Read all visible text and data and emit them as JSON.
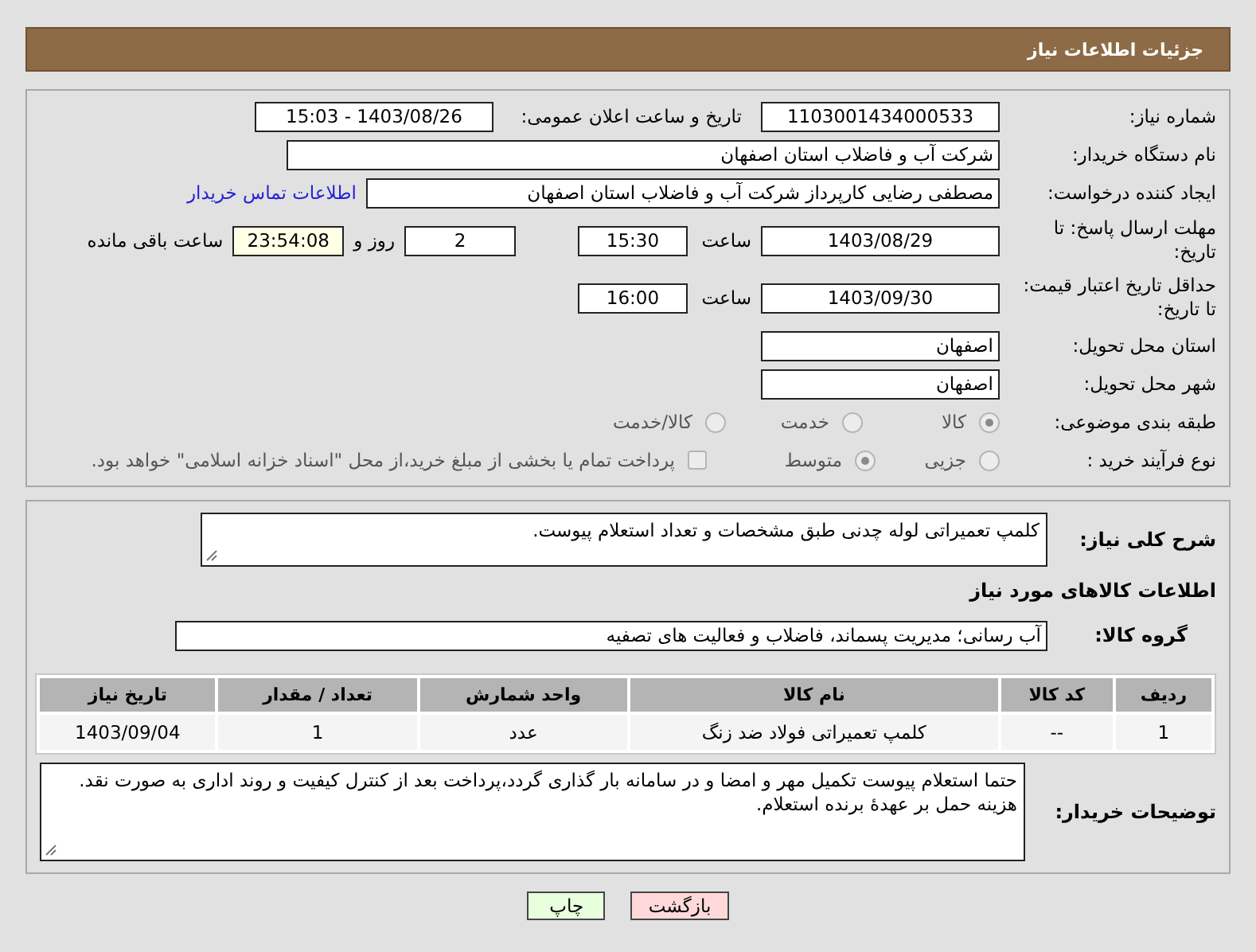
{
  "header": {
    "title": "جزئیات اطلاعات نیاز"
  },
  "need_number": {
    "label": "شماره نیاز:",
    "value": "1103001434000533"
  },
  "announce": {
    "label": "تاریخ و ساعت اعلان عمومی:",
    "value": "1403/08/26 - 15:03"
  },
  "buyer_org": {
    "label": "نام دستگاه خریدار:",
    "value": "شرکت آب و فاضلاب استان اصفهان"
  },
  "requester": {
    "label": "ایجاد کننده درخواست:",
    "value": "مصطفی رضایی کارپرداز شرکت آب و فاضلاب استان اصفهان",
    "link": "اطلاعات تماس خریدار"
  },
  "reply_deadline": {
    "label": "مهلت ارسال پاسخ: تا تاریخ:",
    "date": "1403/08/29",
    "time_label": "ساعت",
    "time": "15:30",
    "days": "2",
    "days_label": "روز و",
    "remaining": "23:54:08",
    "remaining_label": "ساعت باقی مانده"
  },
  "price_validity": {
    "label": "حداقل تاریخ اعتبار قیمت: تا تاریخ:",
    "date": "1403/09/30",
    "time_label": "ساعت",
    "time": "16:00"
  },
  "province": {
    "label": "استان محل تحویل:",
    "value": "اصفهان"
  },
  "city": {
    "label": "شهر محل تحویل:",
    "value": "اصفهان"
  },
  "category": {
    "label": "طبقه بندی موضوعی:",
    "options": [
      {
        "label": "کالا",
        "selected": true
      },
      {
        "label": "خدمت",
        "selected": false
      },
      {
        "label": "کالا/خدمت",
        "selected": false
      }
    ]
  },
  "purchase_type": {
    "label": "نوع فرآیند خرید :",
    "options": [
      {
        "label": "جزیی",
        "selected": false
      },
      {
        "label": "متوسط",
        "selected": true
      }
    ],
    "checkbox": {
      "label": "پرداخت تمام یا بخشی از مبلغ خرید،از محل \"اسناد خزانه اسلامی\" خواهد بود.",
      "checked": false
    }
  },
  "description": {
    "label": "شرح کلی نیاز:",
    "value": "کلمپ تعمیراتی لوله چدنی طبق مشخصات و تعداد استعلام پیوست."
  },
  "goods_title": "اطلاعات کالاهای مورد نیاز",
  "goods_group": {
    "label": "گروه کالا:",
    "value": "آب رسانی؛ مدیریت پسماند، فاضلاب و فعالیت های تصفیه"
  },
  "table": {
    "columns": [
      "ردیف",
      "کد کالا",
      "نام کالا",
      "واحد شمارش",
      "تعداد / مقدار",
      "تاریخ نیاز"
    ],
    "rows": [
      [
        "1",
        "--",
        "کلمپ تعمیراتی فولاد ضد زنگ",
        "عدد",
        "1",
        "1403/09/04"
      ]
    ]
  },
  "buyer_notes": {
    "label": "توضیحات خریدار:",
    "lines": [
      "حتما استعلام پیوست تکمیل مهر و امضا و در سامانه بار گذاری گردد،پرداخت بعد از کنترل کیفیت و روند اداری به صورت نقد.",
      "هزینه حمل بر عهدهٔ برنده استعلام."
    ]
  },
  "buttons": [
    {
      "label": "بازگشت",
      "kind": "back"
    },
    {
      "label": "چاپ",
      "kind": "print"
    }
  ]
}
